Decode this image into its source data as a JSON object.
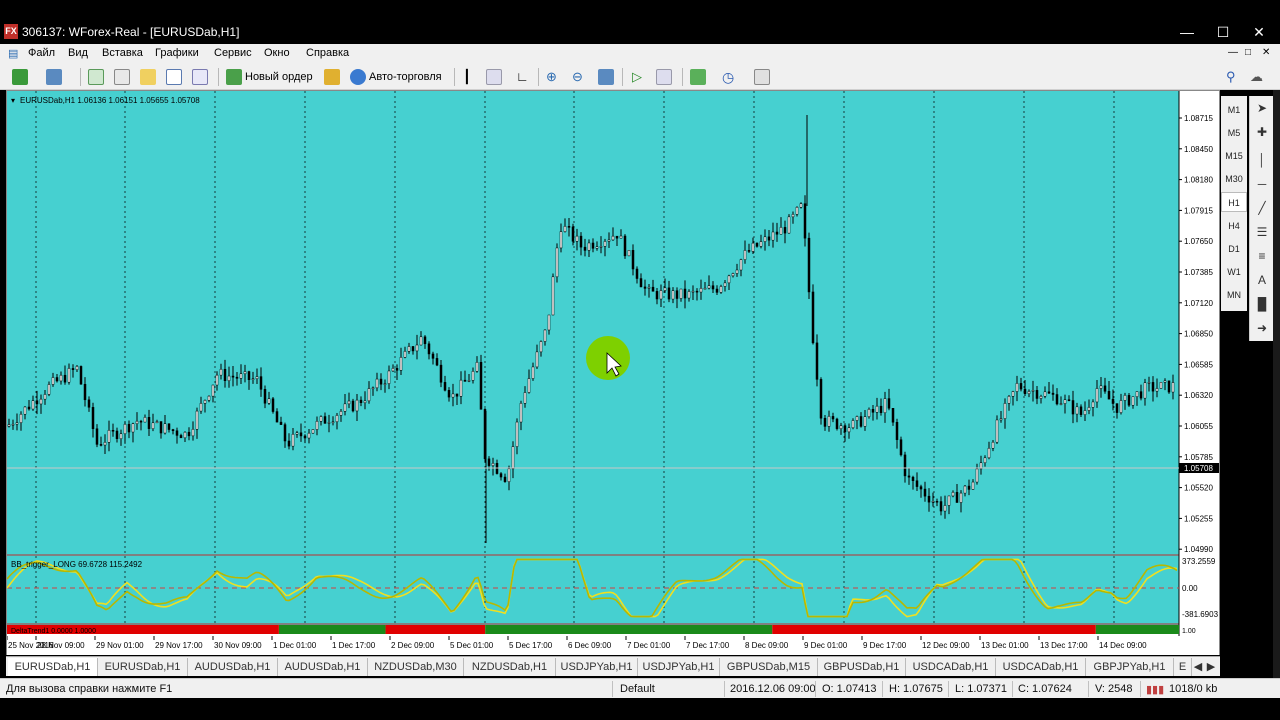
{
  "window": {
    "title": "306137: WForex-Real - [EURUSDab,H1]",
    "app_icon_text": "FX"
  },
  "menu": [
    "Файл",
    "Вид",
    "Вставка",
    "Графики",
    "Сервис",
    "Окно",
    "Справка"
  ],
  "toolbar": {
    "new_order_label": "Новый ордер",
    "auto_trading_label": "Авто-торговля"
  },
  "chart": {
    "header": "EURUSDab,H1  1.06136 1.06151 1.05655 1.05708",
    "price_ticks": [
      "1.08715",
      "1.08450",
      "1.08180",
      "1.07915",
      "1.07650",
      "1.07385",
      "1.07120",
      "1.06850",
      "1.06585",
      "1.06320",
      "1.06055",
      "1.05785",
      "1.05520",
      "1.05255",
      "1.04990"
    ],
    "current_price": "1.05708",
    "time_labels": [
      "25 Nov 2016",
      "28 Nov 09:00",
      "29 Nov 01:00",
      "29 Nov 17:00",
      "30 Nov 09:00",
      "1 Dec 01:00",
      "1 Dec 17:00",
      "2 Dec 09:00",
      "5 Dec 01:00",
      "5 Dec 17:00",
      "6 Dec 09:00",
      "7 Dec 01:00",
      "7 Dec 17:00",
      "8 Dec 09:00",
      "9 Dec 01:00",
      "9 Dec 17:00",
      "12 Dec 09:00",
      "13 Dec 01:00",
      "13 Dec 17:00",
      "14 Dec 09:00"
    ],
    "colors": {
      "background": "#46d0d0",
      "candle": "#000000",
      "bid_line": "#c8c8c8",
      "indicator_line_1": "#f0e020",
      "indicator_line_2": "#b8b800",
      "zero_line": "#d04040",
      "trend_up": "#1a8a1a",
      "trend_down": "#e00000",
      "cursor_circle": "#7ed000"
    }
  },
  "indicator": {
    "label": "BB_trigger_LONG 69.6728 115.2492",
    "ticks": [
      "373.2559",
      "0.00",
      "-381.6903"
    ]
  },
  "trend_bar": {
    "label": "DeltaTrend1 0.0000 1.0000",
    "right_label": "1.00",
    "segments": [
      {
        "state": "down",
        "from": 0.0,
        "to": 0.232
      },
      {
        "state": "up",
        "from": 0.232,
        "to": 0.323
      },
      {
        "state": "down",
        "from": 0.323,
        "to": 0.408
      },
      {
        "state": "up",
        "from": 0.408,
        "to": 0.653
      },
      {
        "state": "down",
        "from": 0.653,
        "to": 0.929
      },
      {
        "state": "up",
        "from": 0.929,
        "to": 1.0
      }
    ]
  },
  "timeframes": [
    "M1",
    "M5",
    "M15",
    "M30",
    "H1",
    "H4",
    "D1",
    "W1",
    "MN"
  ],
  "active_timeframe": "H1",
  "tabs": [
    "EURUSDab,H1",
    "EURUSDab,H1",
    "AUDUSDab,H1",
    "AUDUSDab,H1",
    "NZDUSDab,M30",
    "NZDUSDab,H1",
    "USDJPYab,H1",
    "USDJPYab,H1",
    "GBPUSDab,M15",
    "GBPUSDab,H1",
    "USDCADab,H1",
    "USDCADab,H1",
    "GBPJPYab,H1",
    "E"
  ],
  "status": {
    "help": "Для вызова справки нажмите F1",
    "profile": "Default",
    "datetime": "2016.12.06 09:00",
    "open": "O: 1.07413",
    "high": "H: 1.07675",
    "low": "L: 1.07371",
    "close": "C: 1.07624",
    "volume": "V: 2548",
    "traffic": "1018/0 kb"
  }
}
